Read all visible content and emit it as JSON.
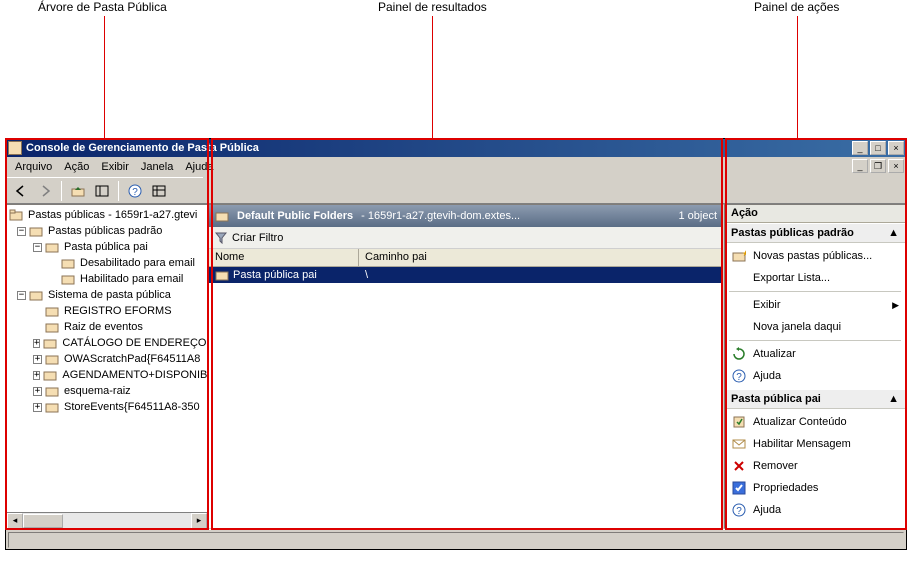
{
  "callouts": {
    "tree": "Árvore de Pasta Pública",
    "results": "Painel de resultados",
    "actions": "Painel de ações"
  },
  "window": {
    "title": "Console de Gerenciamento de Pasta Pública",
    "minimize": "_",
    "maximize": "□",
    "close": "×"
  },
  "menu": {
    "arquivo": "Arquivo",
    "acao": "Ação",
    "exibir": "Exibir",
    "janela": "Janela",
    "ajuda": "Ajuda"
  },
  "tree": {
    "root": "Pastas públicas - 1659r1-a27.gtevi",
    "default_public_folders": "Pastas públicas padrão",
    "parent_public_folder": "Pasta pública pai",
    "mail_disabled": "Desabilitado para email",
    "mail_enabled": "Habilitado para email",
    "system_public_folder": "Sistema de pasta pública",
    "eforms": "REGISTRO EFORMS",
    "events_root": "Raiz de eventos",
    "address_catalog": "CATÁLOGO DE ENDEREÇO",
    "owascratch": "OWAScratchPad{F64511A8",
    "scheduling": "AGENDAMENTO+DISPONIB",
    "schema_root": "esquema-raiz",
    "store_events": "StoreEvents{F64511A8-350"
  },
  "results": {
    "header_title": "Default Public Folders",
    "header_path": "- 1659r1-a27.gtevih-dom.extes...",
    "header_count": "1 object",
    "create_filter": "Criar Filtro",
    "col_name": "Nome",
    "col_parent_path": "Caminho pai",
    "row0_name": "Pasta pública pai",
    "row0_path": "\\"
  },
  "actions": {
    "pane_title": "Ação",
    "section1_title": "Pastas públicas padrão",
    "new_public_folders": "Novas pastas públicas...",
    "export_list": "Exportar Lista...",
    "view": "Exibir",
    "new_window": "Nova janela daqui",
    "refresh": "Atualizar",
    "help": "Ajuda",
    "section2_title": "Pasta pública pai",
    "update_content": "Atualizar Conteúdo",
    "enable_message": "Habilitar Mensagem",
    "remove": "Remover",
    "properties": "Propriedades",
    "help2": "Ajuda",
    "collapse_marker": "▲"
  },
  "colors": {
    "accent": "#0a246a",
    "redline": "#d00000"
  }
}
